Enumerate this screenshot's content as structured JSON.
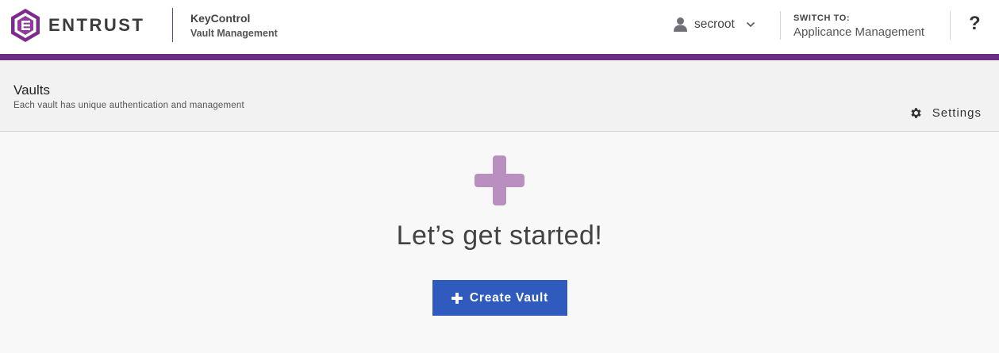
{
  "header": {
    "brand": "ENTRUST",
    "product_name": "KeyControl",
    "product_sub": "Vault Management",
    "user": {
      "name": "secroot",
      "icon": "user-icon",
      "menu_icon": "chevron-down-icon"
    },
    "switch": {
      "label": "SWITCH TO:",
      "target": "Applicance Management"
    },
    "help_label": "?"
  },
  "page": {
    "title": "Vaults",
    "description": "Each vault has unique authentication and management",
    "settings_label": "Settings",
    "settings_icon": "gear-icon"
  },
  "empty_state": {
    "icon": "plus-icon",
    "headline": "Let’s get started!",
    "button_label": "Create Vault"
  },
  "colors": {
    "brand_purple": "#6b2c82",
    "plus_purple": "#b98fc0",
    "button_blue": "#2f5bbf"
  }
}
